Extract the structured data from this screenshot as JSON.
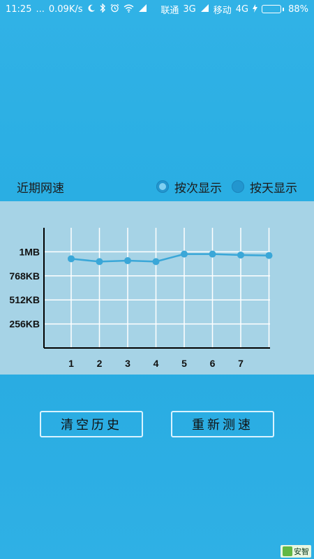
{
  "status_bar": {
    "time": "11:25",
    "dots": "...",
    "net_speed": "0.09K/s",
    "icons": [
      "moon-icon",
      "bluetooth-icon",
      "alarm-icon",
      "wifi-icon",
      "signal-icon"
    ],
    "carrier1": "联通",
    "net1": "3G",
    "carrier2": "移动",
    "net2": "4G",
    "battery": "88%",
    "battery_level": 0.88,
    "battery_color": "#6ee37a"
  },
  "header": {
    "title": "近期网速",
    "radio_by_count": "按次显示",
    "radio_by_day": "按天显示",
    "selected": "by_count"
  },
  "buttons": {
    "clear": "清空历史",
    "retest": "重新测速"
  },
  "watermark": {
    "text": "安智"
  },
  "colors": {
    "background": "#2aaee3",
    "chart_panel": "#a6d3e6",
    "line": "#3aa7d8",
    "grid": "#ffffff",
    "axis": "#000000"
  },
  "chart_data": {
    "type": "line",
    "categories": [
      "1",
      "2",
      "3",
      "4",
      "5",
      "6",
      "7",
      ""
    ],
    "y_tick_labels": [
      "256KB",
      "512KB",
      "768KB",
      "1MB"
    ],
    "y_ticks_kb": [
      256,
      512,
      768,
      1024
    ],
    "ylim": [
      0,
      1280
    ],
    "values": [
      950,
      920,
      930,
      920,
      1000,
      1000,
      990,
      985
    ],
    "grid": true,
    "legend": "none"
  }
}
